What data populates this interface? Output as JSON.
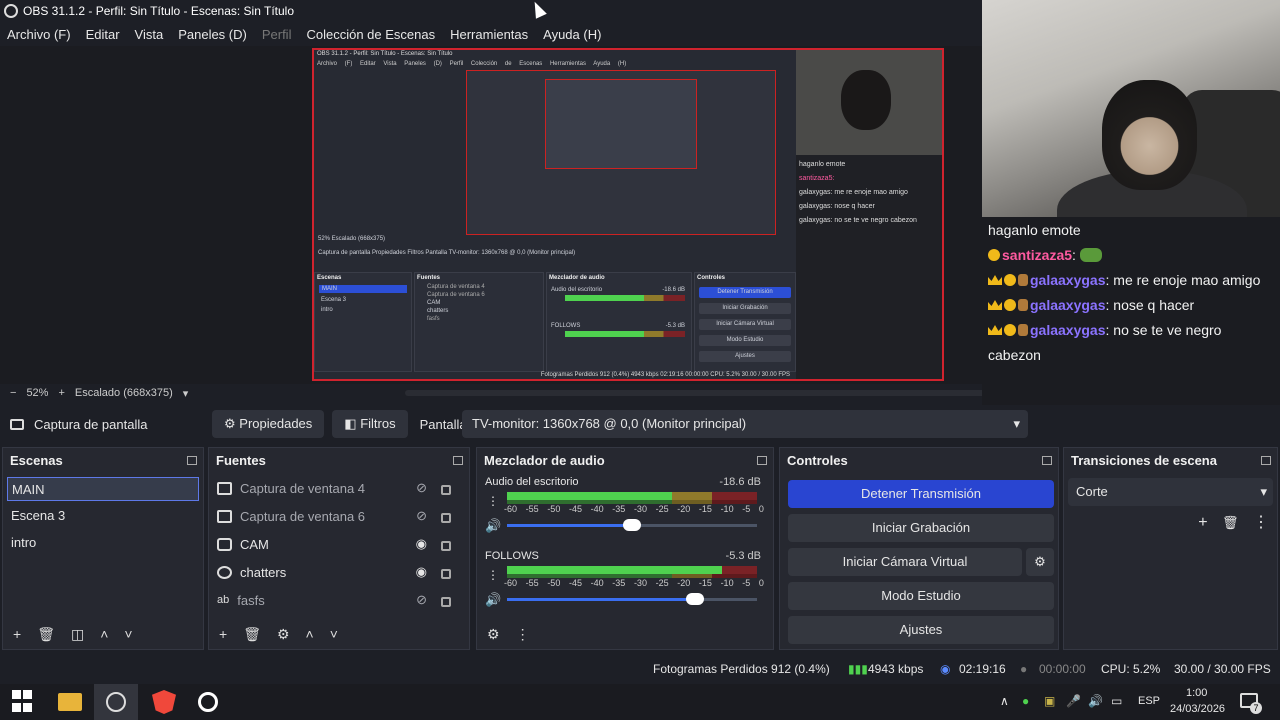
{
  "window": {
    "title": "OBS 31.1.2 - Perfil: Sin Título - Escenas: Sin Título"
  },
  "menu": [
    "Archivo (F)",
    "Editar",
    "Vista",
    "Paneles (D)",
    "Perfil",
    "Colección de Escenas",
    "Herramientas",
    "Ayuda (H)"
  ],
  "nested": {
    "title": "OBS 31.1.2 - Perfil: Sin Título - Escenas: Sin Título",
    "menu": "Archivo (F) Editar Vista Paneles (D) Perfil Colección de Escenas Herramientas Ayuda (H)",
    "zoom": "52%   Escalado (668x375)",
    "srcbar": "Captura de pantalla   Propiedades   Filtros   Pantalla   TV-monitor: 1360x768 @ 0,0 (Monitor principal)",
    "scenes_title": "Escenas",
    "scenes": [
      "MAIN",
      "Escena 3",
      "intro"
    ],
    "sources_title": "Fuentes",
    "sources": [
      "Captura de ventana 4",
      "Captura de ventana 6",
      "CAM",
      "chatters",
      "fasfs"
    ],
    "mixer_title": "Mezclador de audio",
    "ch1": "Audio del escritorio",
    "ch1_db": "-18.6 dB",
    "ch2": "FOLLOWS",
    "ch2_db": "-5.3 dB",
    "controls_title": "Controles",
    "ctrl": [
      "Detener Transmisión",
      "Iniciar Grabación",
      "Iniciar Cámara Virtual",
      "Modo Estudio",
      "Ajustes"
    ],
    "trans_title": "Transiciones de escena",
    "trans": "Corte",
    "status": "Fotogramas Perdidos 912 (0.4%)   4943 kbps   02:19:16   00:00:00   CPU: 5.2%   30.00 / 30.00 FPS",
    "chat": [
      "haganlo emote",
      "santizaza5:",
      "galaxygas: me re enoje mao amigo",
      "galaxygas: nose q hacer",
      "galaxygas: no se te ve negro cabezon"
    ]
  },
  "preview_toolbar": {
    "zoom": "52%",
    "scaled": "Escalado (668x375)"
  },
  "source_toolbar": {
    "source_name": "Captura de pantalla",
    "properties": "Propiedades",
    "filters": "Filtros",
    "display_label": "Pantalla",
    "display_value": "TV-monitor: 1360x768 @ 0,0 (Monitor principal)"
  },
  "chat": {
    "line1": "haganlo emote",
    "line2_user": "santizaza5",
    "line3_user": "galaaxygas",
    "line3_msg": ": me re enoje mao amigo",
    "line4_user": "galaaxygas",
    "line4_msg": ": nose q hacer",
    "line5_user": "galaaxygas",
    "line5_msg": ": no se te ve negro cabezon"
  },
  "scenes": {
    "title": "Escenas",
    "items": [
      "MAIN",
      "Escena 3",
      "intro"
    ]
  },
  "sources": {
    "title": "Fuentes",
    "items": [
      "Captura de ventana 4",
      "Captura de ventana 6",
      "CAM",
      "chatters",
      "fasfs"
    ]
  },
  "mixer": {
    "title": "Mezclador de audio",
    "channels": [
      {
        "name": "Audio del escritorio",
        "db": "-18.6 dB",
        "level": 0.66,
        "volume": 0.5
      },
      {
        "name": "FOLLOWS",
        "db": "-5.3 dB",
        "level": 0.86,
        "volume": 0.75
      }
    ],
    "ticks": [
      "-60",
      "-55",
      "-50",
      "-45",
      "-40",
      "-35",
      "-30",
      "-25",
      "-20",
      "-15",
      "-10",
      "-5",
      "0"
    ]
  },
  "controls": {
    "title": "Controles",
    "stop_stream": "Detener Transmisión",
    "start_record": "Iniciar Grabación",
    "start_vcam": "Iniciar Cámara Virtual",
    "studio_mode": "Modo Estudio",
    "settings": "Ajustes"
  },
  "transitions": {
    "title": "Transiciones de escena",
    "selected": "Corte"
  },
  "status": {
    "dropped": "Fotogramas Perdidos 912 (0.4%)",
    "bitrate": "4943 kbps",
    "stream_time": "02:19:16",
    "rec_time": "00:00:00",
    "cpu": "CPU: 5.2%",
    "fps": "30.00 / 30.00 FPS"
  },
  "taskbar": {
    "lang": "ESP",
    "time": "1:00",
    "date": "24/03/2026",
    "notif": "7"
  },
  "colors": {
    "accent": "#2945d1",
    "live_border": "#d0232e",
    "meter_green": "#4fd24f"
  }
}
